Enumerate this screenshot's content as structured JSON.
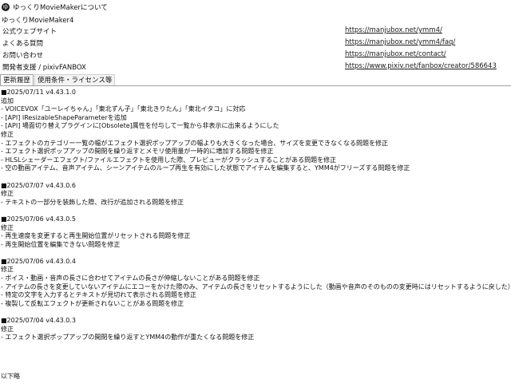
{
  "window": {
    "icon_letter": "ゆ",
    "title": "ゆっくりMovieMakerについて"
  },
  "app_name": "ゆっくりMovieMaker4",
  "links": [
    {
      "label": "公式ウェブサイト",
      "url": "https://manjubox.net/ymm4/"
    },
    {
      "label": "よくある質問",
      "url": "https://manjubox.net/ymm4/faq/"
    },
    {
      "label": "お問い合わせ",
      "url": "https://manjubox.net/contact/"
    },
    {
      "label": "開発者支援 / pixivFANBOX",
      "url": "https://www.pixiv.net/fanbox/creator/586643"
    }
  ],
  "tabs": [
    {
      "label": "更新履歴",
      "active": true
    },
    {
      "label": "使用条件・ライセンス等",
      "active": false
    }
  ],
  "changelog": [
    "■2025/07/11 v4.43.1.0",
    "追加",
    "- VOICEVOX「ユーレイちゃん」「東北ずん子」「東北きりたん」「東北イタコ」に対応",
    "- [API] IResizableShapeParameterを追加",
    "- [API] 場面切り替えプラグインに[Obsolete]属性を付与して一覧から非表示に出来るようにした",
    "修正",
    "- エフェクトのカテゴリー一覧の幅がエフェクト選択ポップアップの幅よりも大きくなった場合、サイズを変更できなくなる問題を修正",
    "- エフェクト選択ポップアップの開閉を繰り返すとメモリ使用量が一時的に増加する問題を修正",
    "- HLSLシェーダーエフェクト/ファイルエフェクトを使用した際、プレビューがクラッシュすることがある問題を修正",
    "- 空の動画アイテム、音声アイテム、シーンアイテムのループ再生を有効にした状態でアイテムを編集すると、YMM4がフリーズする問題を修正",
    "",
    "■2025/07/07 v4.43.0.6",
    "修正",
    "- テキストの一部分を装飾した際、改行が追加される問題を修正",
    "",
    "■2025/07/06 v4.43.0.5",
    "修正",
    "- 再生速度を変更すると再生開始位置がリセットされる問題を修正",
    "- 再生開始位置を編集できない問題を修正",
    "",
    "■2025/07/06 v4.43.0.4",
    "修正",
    "- ボイス・動画・音声の長さに合わせてアイテムの長さが伸縮しないことがある問題を修正",
    "- アイテムの長さを変更していないアイテムにエコーをかけた際のみ、アイテムの長さをリセットするようにした（動画や音声のそのものの変更時にはリセットするように戻した）",
    "- 特定の文字を入力するとテキストが見切れて表示される問題を修正",
    "- 複製して反転エフェクトが更新されないことがある問題を修正",
    "",
    "■2025/07/04 v4.43.0.3",
    "修正",
    "- エフェクト選択ポップアップの開閉を繰り返すとYMM4の動作が重たくなる問題を修正"
  ],
  "footer": "以下略"
}
